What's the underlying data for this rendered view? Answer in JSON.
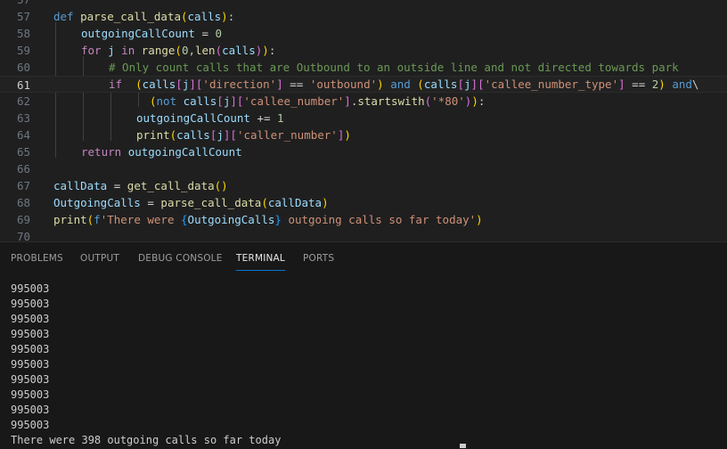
{
  "editor": {
    "lines": [
      {
        "num": "57"
      },
      {
        "num": "58"
      },
      {
        "num": "59"
      },
      {
        "num": "60"
      },
      {
        "num": "61"
      },
      {
        "num": "62"
      },
      {
        "num": "63"
      },
      {
        "num": "64"
      },
      {
        "num": "65"
      },
      {
        "num": "66"
      },
      {
        "num": "67"
      },
      {
        "num": "68"
      },
      {
        "num": "69"
      },
      {
        "num": "70"
      }
    ],
    "t": {
      "def": "def",
      "fn_parse": "parse_call_data",
      "calls": "calls",
      "colon": ":",
      "occ": "outgoingCallCount",
      "eq": " = ",
      "zero": "0",
      "for": "for",
      "j": "j",
      "in": "in",
      "range": "range",
      "len": "len",
      "zero_comma": "0,",
      "comment": "# Only count calls that are Outbound to an outside line and not directed towards park",
      "if": "if",
      "s_direction": "'direction'",
      "eqeq": " == ",
      "s_outbound": "'outbound'",
      "and": "and",
      "s_callee_type": "'callee_number_type'",
      "two": "2",
      "backslash": "\\",
      "not": "not",
      "s_callee_number": "'callee_number'",
      "startswith": "startswith",
      "s_80": "'*80'",
      "pluseq": " += ",
      "one": "1",
      "print": "print",
      "s_caller_number": "'caller_number'",
      "return": "return",
      "callData": "callData",
      "get_call_data": "get_call_data",
      "OutgoingCalls": "OutgoingCalls",
      "fprefix": "f",
      "s_there1": "'There were ",
      "fvar": "OutgoingCalls",
      "s_there2": " outgoing calls so far today'"
    }
  },
  "panel": {
    "tabs": [
      "PROBLEMS",
      "OUTPUT",
      "DEBUG CONSOLE",
      "TERMINAL",
      "PORTS"
    ],
    "active_tab": "TERMINAL",
    "terminal_lines": [
      "995003",
      "995003",
      "995003",
      "995003",
      "995003",
      "995003",
      "995003",
      "995003",
      "995003",
      "995003",
      "There were 398 outgoing calls so far today"
    ]
  },
  "colors": {
    "accent": "#0078d4",
    "background": "#1f1f1f",
    "panel": "#181818"
  }
}
